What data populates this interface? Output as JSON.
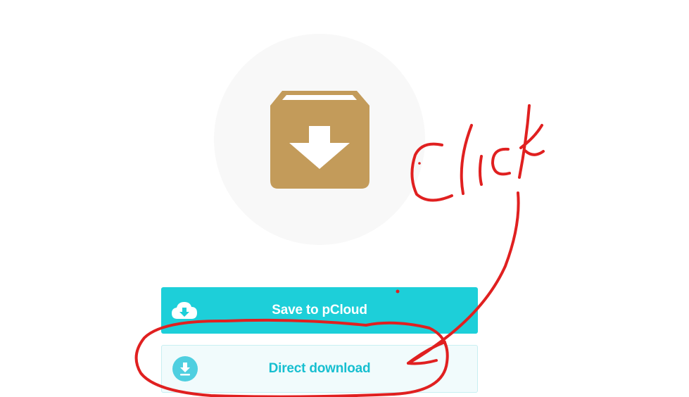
{
  "hero": {
    "icon": "archive-download-icon",
    "icon_color": "#c39b5a",
    "circle_color": "#f8f8f8"
  },
  "actions": {
    "save_label": "Save to pCloud",
    "save_icon": "cloud-upload-icon",
    "save_color": "#1dcfd9",
    "direct_label": "Direct download",
    "direct_icon": "download-circle-icon",
    "direct_color": "#17bfd0"
  },
  "annotation": {
    "text": "Click",
    "color": "#e02020"
  }
}
